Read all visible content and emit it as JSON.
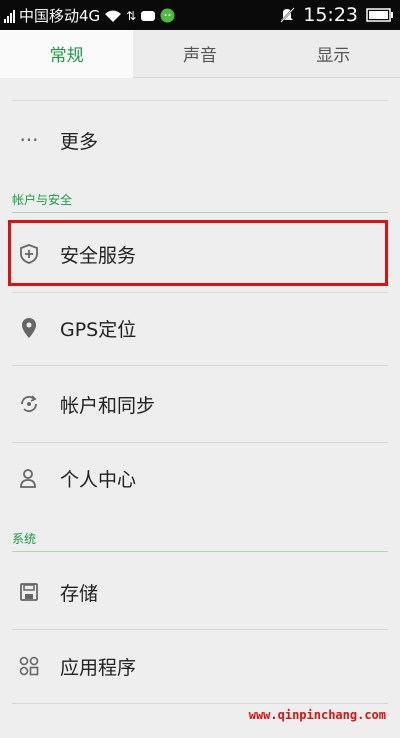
{
  "status_bar": {
    "carrier": "中国移动4G",
    "time": "15:23"
  },
  "tabs": [
    {
      "label": "常规",
      "active": true
    },
    {
      "label": "声音",
      "active": false
    },
    {
      "label": "显示",
      "active": false
    }
  ],
  "menu": {
    "more_label": "更多",
    "section_account": "帐户与安全",
    "security_service": "安全服务",
    "gps": "GPS定位",
    "account_sync": "帐户和同步",
    "personal_center": "个人中心",
    "section_system": "系统",
    "storage": "存储",
    "apps": "应用程序"
  },
  "colors": {
    "accent": "#1a9b46",
    "highlight": "#e01010"
  },
  "watermark": "www.qinpinchang.com"
}
